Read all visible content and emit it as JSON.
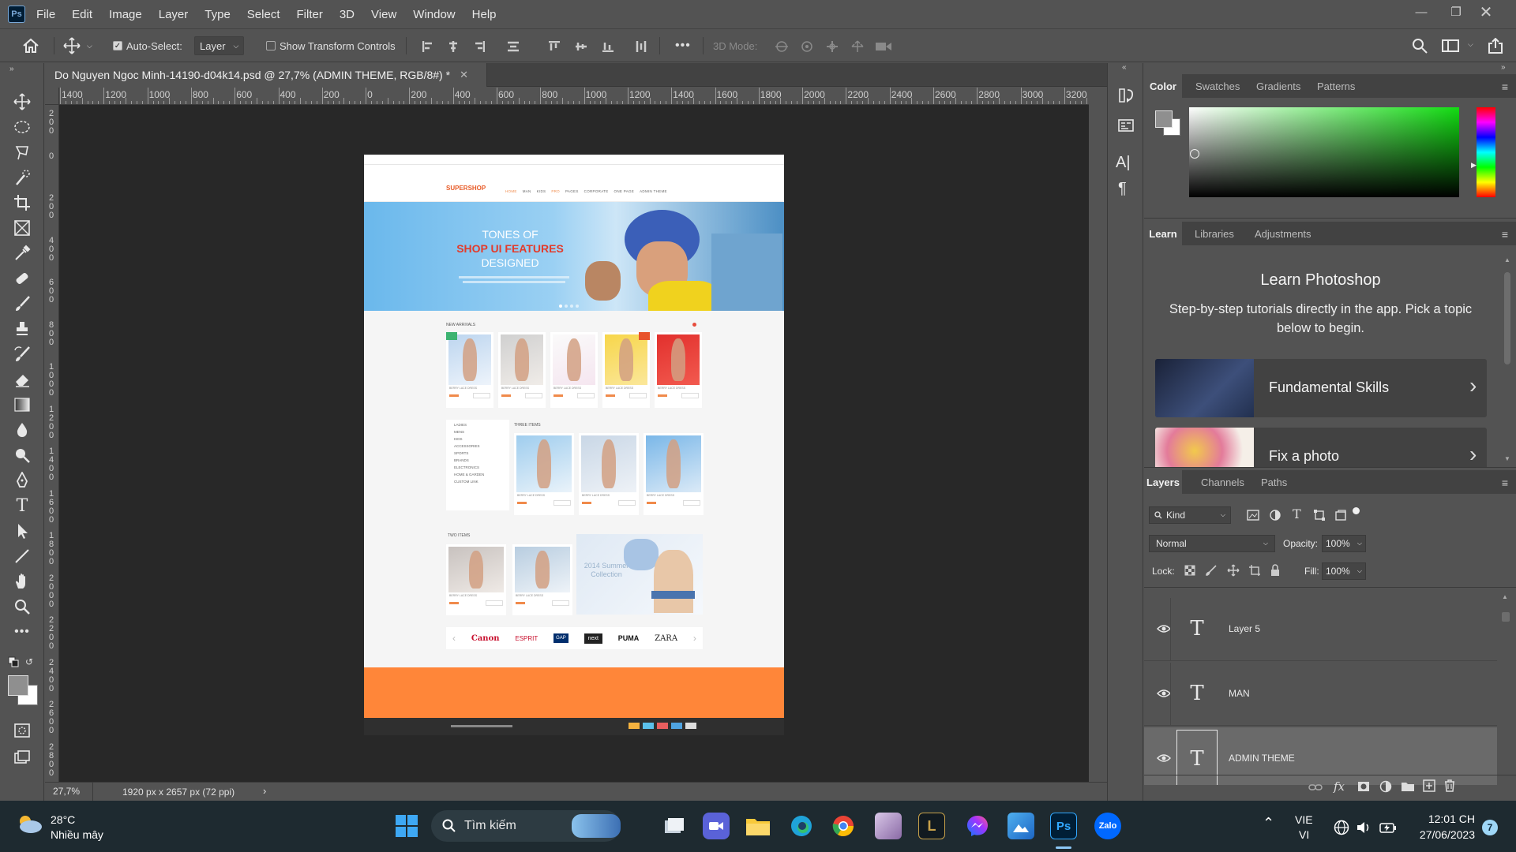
{
  "app": {
    "logo": "Ps",
    "menu": [
      "File",
      "Edit",
      "Image",
      "Layer",
      "Type",
      "Select",
      "Filter",
      "3D",
      "View",
      "Window",
      "Help"
    ]
  },
  "options_bar": {
    "auto_select_label": "Auto-Select:",
    "auto_select_checked": true,
    "auto_select_target": "Layer",
    "show_transform_label": "Show Transform Controls",
    "show_transform_checked": false,
    "mode_3d_label": "3D Mode:",
    "more_label": "•••"
  },
  "document": {
    "tab_title": "Do Nguyen Ngoc Minh-14190-d04k14.psd @ 27,7% (ADMIN THEME, RGB/8#) *",
    "zoom": "27,7%",
    "info": "1920 px x 2657 px (72 ppi)",
    "ruler_h": [
      "1400",
      "1200",
      "1000",
      "800",
      "600",
      "400",
      "200",
      "0",
      "200",
      "400",
      "600",
      "800",
      "1000",
      "1200",
      "1400",
      "1600",
      "1800",
      "2000",
      "2200",
      "2400",
      "2600",
      "2800",
      "3000",
      "3200"
    ],
    "ruler_v": [
      "2\n0\n0",
      "0",
      "2\n0\n0",
      "4\n0\n0",
      "6\n0\n0",
      "8\n0\n0",
      "1\n0\n0\n0",
      "1\n2\n0\n0",
      "1\n4\n0\n0",
      "1\n6\n0\n0",
      "1\n8\n0\n0",
      "2\n0\n0\n0",
      "2\n2\n0\n0",
      "2\n4\n0\n0",
      "2\n6\n0\n0",
      "2\n8\n0\n0"
    ]
  },
  "mockup": {
    "logo": "SUPERSHOP",
    "nav": [
      "HOME",
      "MAN",
      "KIDS",
      "PRO",
      "PAGES",
      "CORPORATE",
      "ONE PAGE",
      "ADMIN THEME"
    ],
    "hero_line1": "TONES OF",
    "hero_line2": "SHOP UI FEATURES",
    "hero_line3": "DESIGNED",
    "new_arrivals": "NEW ARRIVALS",
    "three_items": "THREE ITEMS",
    "two_items": "TWO ITEMS",
    "product_label": "BERRY LACE DRESS",
    "categories": [
      "LADIES",
      "MENS",
      "KIDS",
      "ACCESSORIES",
      "SPORTS",
      "BRANDS",
      "ELECTRONICS",
      "HOME & GARDEN",
      "CUSTOM LINK"
    ],
    "summer": "2014 Summer Collection",
    "brands": [
      "Canon",
      "ESPRIT",
      "GAP",
      "next",
      "PUMA",
      "ZARA"
    ]
  },
  "panels": {
    "color_tabs": [
      "Color",
      "Swatches",
      "Gradients",
      "Patterns"
    ],
    "learn_tabs": [
      "Learn",
      "Libraries",
      "Adjustments"
    ],
    "learn_title": "Learn Photoshop",
    "learn_desc": "Step-by-step tutorials directly in the app. Pick a topic below to begin.",
    "learn_cards": [
      "Fundamental Skills",
      "Fix a photo"
    ],
    "layers_tabs": [
      "Layers",
      "Channels",
      "Paths"
    ],
    "kind_label": "Kind",
    "blend_mode": "Normal",
    "opacity_label": "Opacity:",
    "opacity_value": "100%",
    "lock_label": "Lock:",
    "fill_label": "Fill:",
    "fill_value": "100%",
    "layers": [
      {
        "name": "Layer 5",
        "type": "T",
        "visible": true
      },
      {
        "name": "MAN",
        "type": "T",
        "visible": true
      },
      {
        "name": "ADMIN THEME",
        "type": "T",
        "visible": true,
        "selected": true
      }
    ]
  },
  "taskbar": {
    "weather_temp": "28°C",
    "weather_desc": "Nhiều mây",
    "search_placeholder": "Tìm kiếm",
    "lang1": "VIE",
    "lang2": "VI",
    "time": "12:01 CH",
    "date": "27/06/2023",
    "notif_count": "7"
  }
}
